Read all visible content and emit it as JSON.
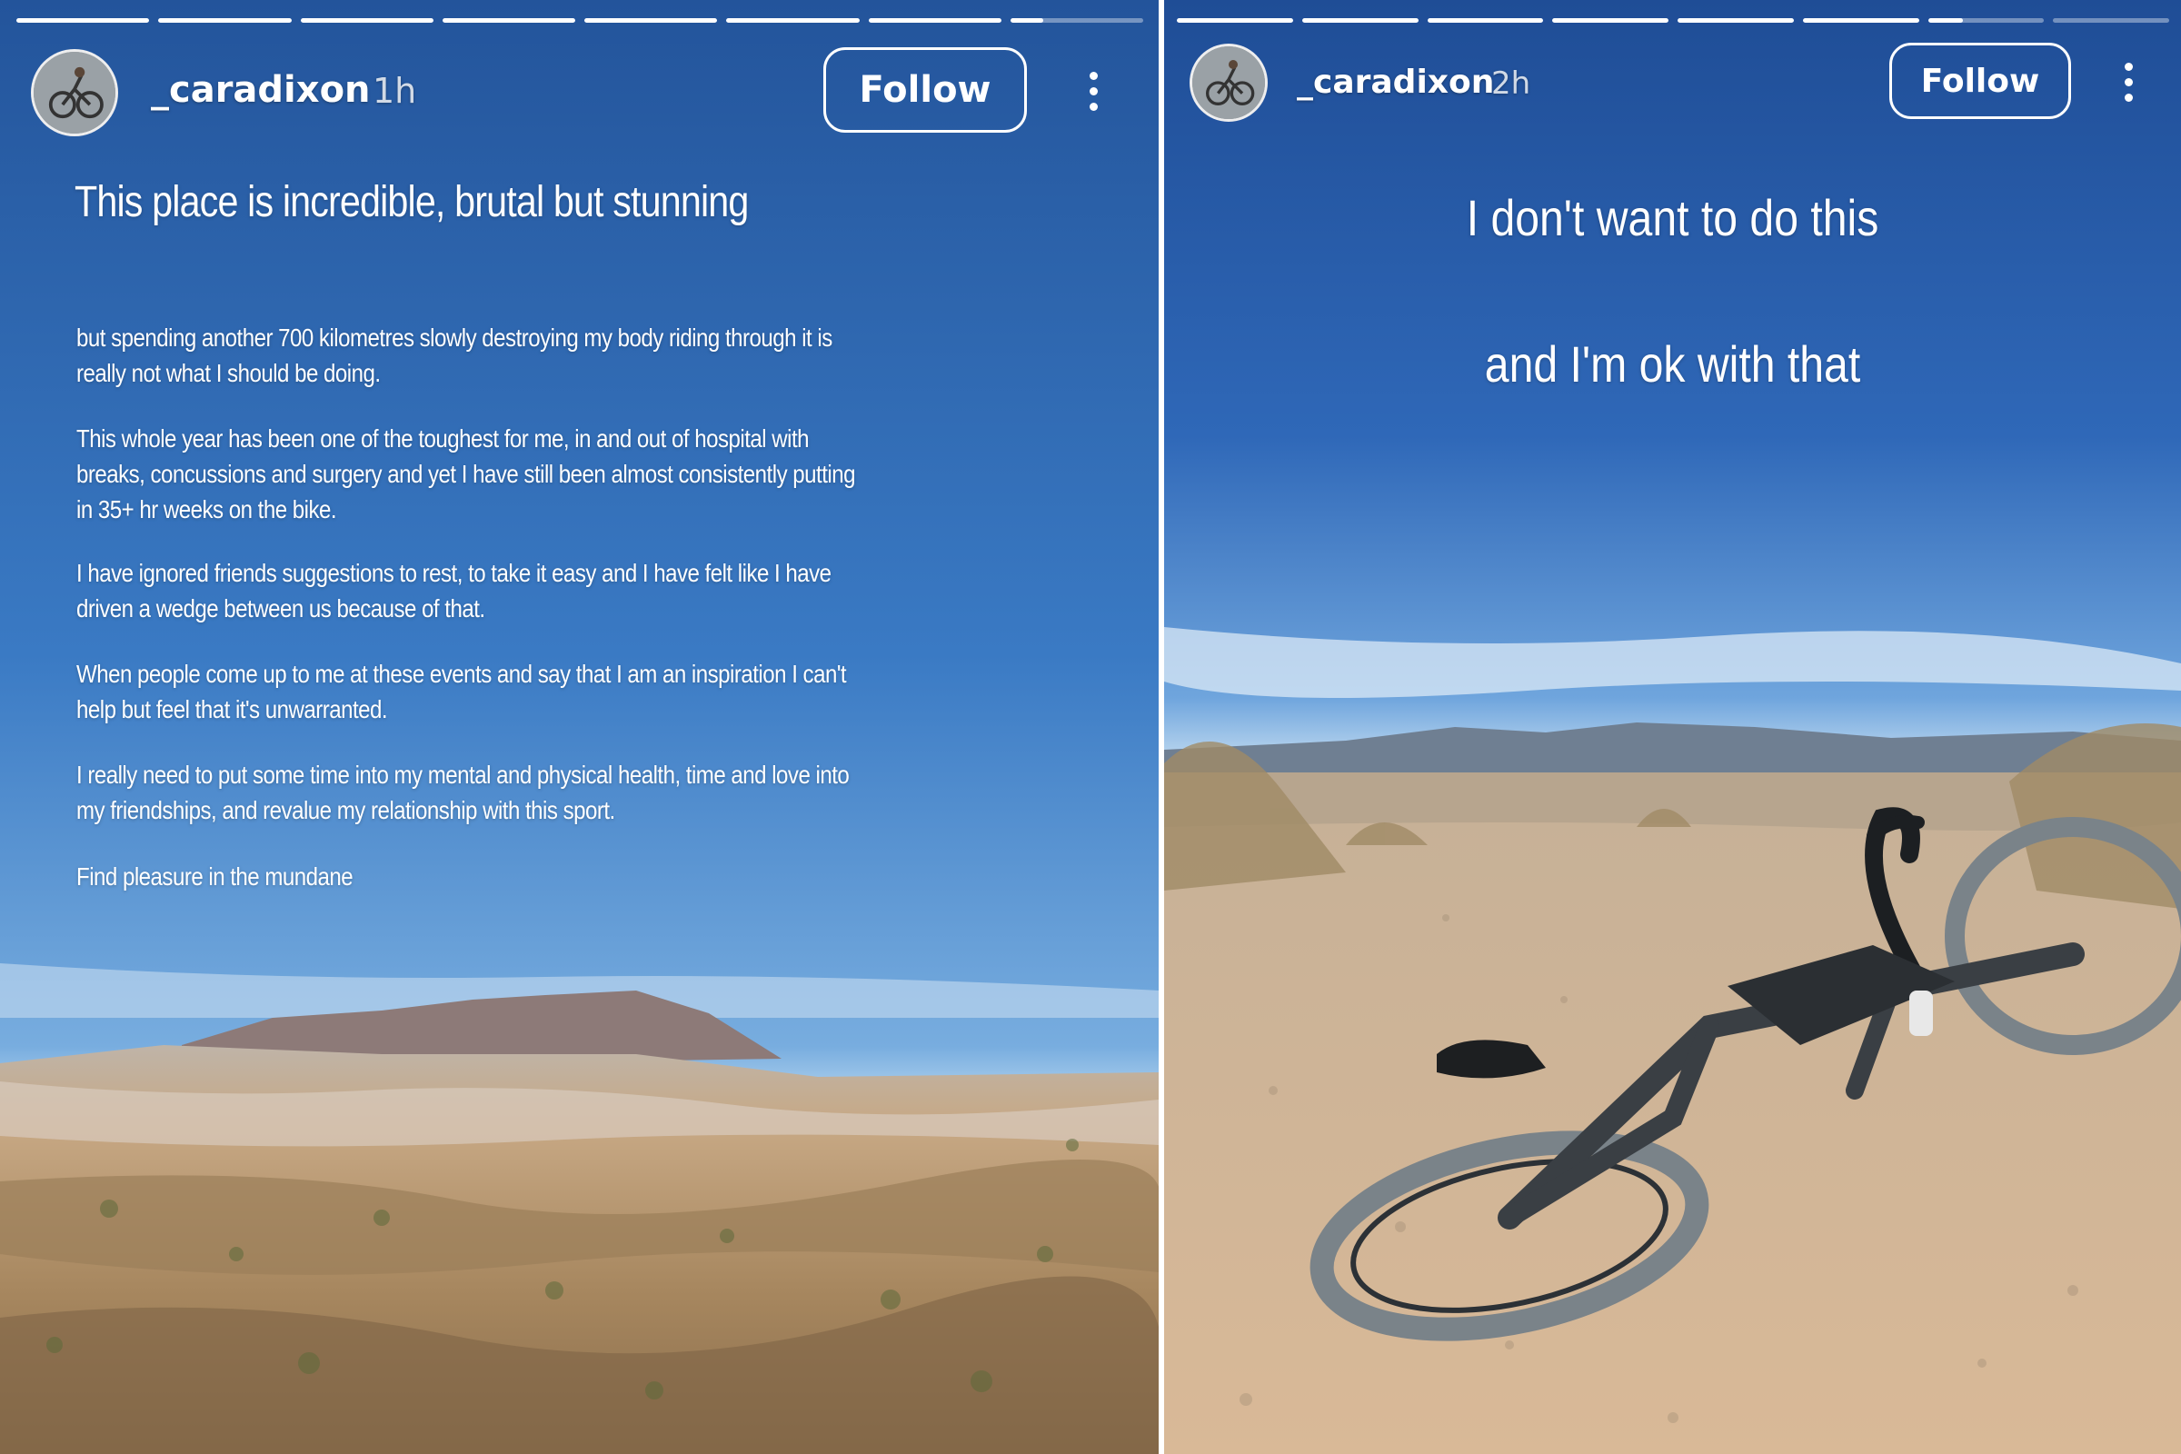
{
  "stories": [
    {
      "username": "_caradixon",
      "time": "1h",
      "follow_label": "Follow",
      "progress_segments": 8,
      "progress_complete": 7,
      "progress_current_fraction": 0.25,
      "headline": "This place is incredible, brutal but stunning",
      "paragraphs": [
        "but spending another 700 kilometres slowly destroying my body riding through it is really not what I should be doing.",
        "This whole year has been one of the toughest for me, in and out of hospital with breaks, concussions and surgery and yet I have still been almost consistently putting in 35+ hr weeks on the bike.",
        "I have ignored friends suggestions to rest, to take it easy and I have felt like I have driven a wedge between us because of that.",
        "When people come up to me at these events and say that I am an inspiration I can't help but feel  that it's unwarranted.",
        "I really need to put some time into my mental and physical health, time and love into my friendships, and revalue my relationship with this sport.",
        "Find pleasure in the mundane"
      ]
    },
    {
      "username": "_caradixon",
      "time": "2h",
      "follow_label": "Follow",
      "progress_segments": 8,
      "progress_complete": 6,
      "progress_current_fraction": 0.3,
      "lines": [
        "I don't want to do this",
        "and I'm ok with that"
      ]
    }
  ],
  "colors": {
    "sky_top": "#2a5da6",
    "sky_bottom": "#7fb2e2",
    "terrain": "#b89a74",
    "text": "#ffffff"
  },
  "icons": [
    "more-options-icon",
    "avatar"
  ]
}
